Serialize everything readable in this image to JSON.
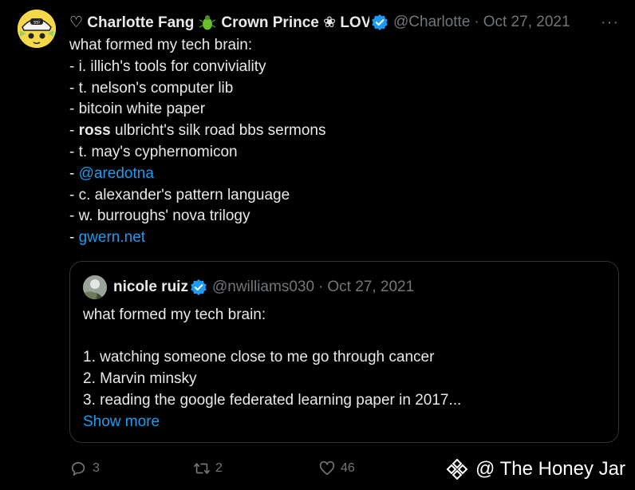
{
  "tweet": {
    "author_name": "♡ Charlotte Fang",
    "author_name_2": "Crown Prince ❀ LOV",
    "handle": "@Charlotte",
    "separator": "·",
    "date": "Oct 27, 2021",
    "more": "···",
    "lines": [
      {
        "text": "what formed my tech brain:"
      },
      {
        "text": "- i. illich's tools for conviviality"
      },
      {
        "text": "- t. nelson's computer lib"
      },
      {
        "text": "- bitcoin white paper"
      },
      {
        "prefix": "- ",
        "bold": "ross",
        "rest": " ulbricht's silk road bbs sermons"
      },
      {
        "text": "- t. may's cyphernomicon"
      },
      {
        "prefix": "- ",
        "link": "@aredotna"
      },
      {
        "text": "- c. alexander's pattern language"
      },
      {
        "text": "- w. burroughs' nova trilogy"
      },
      {
        "prefix": "- ",
        "link": "gwern.net"
      }
    ]
  },
  "quote": {
    "author_name": "nicole ruiz",
    "handle": "@nwilliams030",
    "separator": "·",
    "date": "Oct 27, 2021",
    "lines": [
      "what formed my tech brain:",
      "",
      "1. watching someone close to me go through cancer",
      "2. Marvin minsky",
      "3. reading the google federated learning paper in 2017..."
    ],
    "show_more": "Show more"
  },
  "actions": {
    "replies": "3",
    "retweets": "2",
    "likes": "46"
  },
  "watermark": "@ The Honey Jar",
  "colors": {
    "background": "#000000",
    "text": "#e7e9ea",
    "muted": "#71767b",
    "link": "#1d9bf0",
    "verified": "#1d9bf0",
    "border": "#2f3336"
  }
}
